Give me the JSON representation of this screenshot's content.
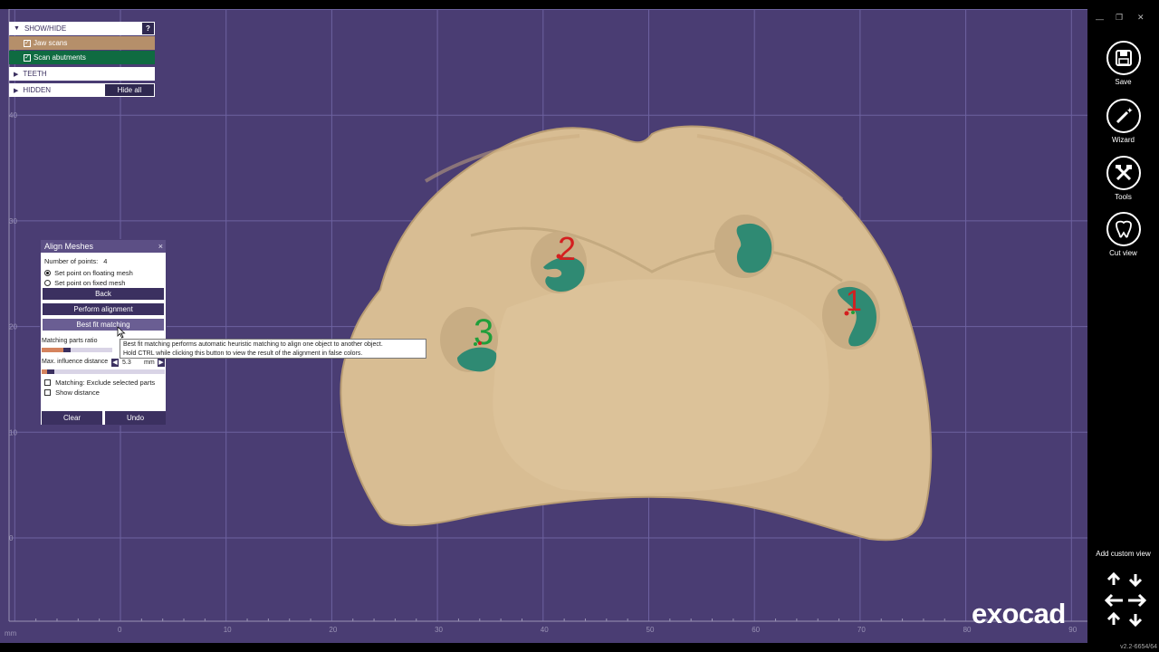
{
  "app": {
    "logo": "exocad",
    "version": "v2.2-6654/64"
  },
  "viewport": {
    "y_axis_ticks": [
      "40",
      "30",
      "20",
      "10",
      "0"
    ],
    "x_axis_ticks": [
      "0",
      "10",
      "20",
      "30",
      "40",
      "50",
      "60",
      "70",
      "80",
      "90"
    ],
    "unit": "mm",
    "markers": [
      "1",
      "2",
      "3"
    ]
  },
  "show_hide": {
    "header": "SHOW/HIDE",
    "help": "?",
    "jaw_scans": "Jaw scans",
    "scan_abutments": "Scan abutments",
    "teeth": "TEETH",
    "hidden": "HIDDEN",
    "hide_all": "Hide all"
  },
  "align_dialog": {
    "title": "Align Meshes",
    "close": "×",
    "num_points_label": "Number of points:",
    "num_points_value": "4",
    "radio_floating": "Set point on floating mesh",
    "radio_fixed": "Set point on fixed mesh",
    "back": "Back",
    "perform": "Perform alignment",
    "best_fit": "Best fit matching",
    "matching_ratio_label": "Matching parts ratio",
    "max_influence_label": "Max. influence distance",
    "max_influence_value": "5.3",
    "max_influence_unit": "mm",
    "exclude_label": "Matching: Exclude selected parts",
    "show_distance_label": "Show distance",
    "clear": "Clear",
    "undo": "Undo"
  },
  "tooltip": {
    "line1": "Best fit matching performs automatic heuristic matching to align one object to another object.",
    "line2": "Hold CTRL while clicking this button to view the result of the alignment in false colors."
  },
  "toolbar": {
    "save": "Save",
    "wizard": "Wizard",
    "tools": "Tools",
    "cut_view": "Cut view",
    "add_custom_view": "Add custom view"
  },
  "colors": {
    "background": "#4a3d73",
    "model": "#d8bd93",
    "abutment": "#2f8a73",
    "marker_red": "#d41f1f",
    "marker_green": "#1f9e3a"
  }
}
